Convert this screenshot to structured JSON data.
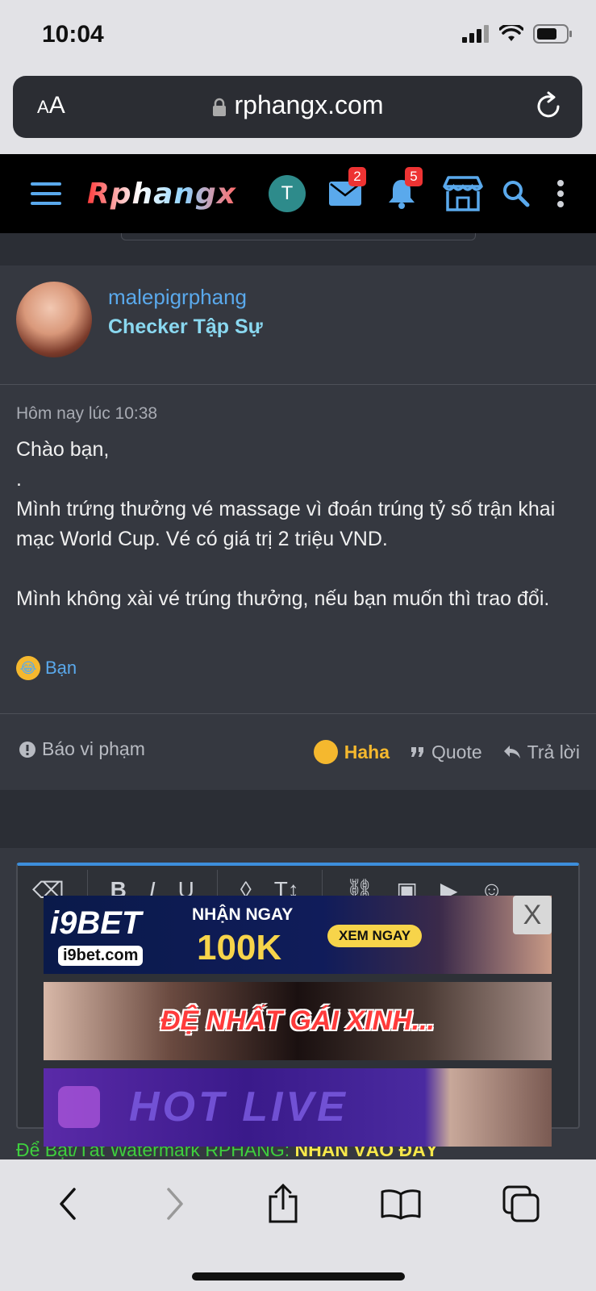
{
  "status_bar": {
    "time": "10:04"
  },
  "browser": {
    "text_size_label": "AA",
    "url": "rphangx.com"
  },
  "header": {
    "logo": "Rphangx",
    "user_initial": "T",
    "messages_count": "2",
    "alerts_count": "5"
  },
  "post": {
    "username": "malepigrphang",
    "user_title": "Checker Tập Sự",
    "timestamp": "Hôm nay lúc 10:38",
    "body": [
      "Chào bạn,",
      ".",
      "Mình trứng thưởng vé massage vì đoán trúng tỷ số trận khai mạc World Cup. Vé có giá trị 2 triệu VND.",
      "",
      "Mình không xài vé trúng thưởng, nếu bạn muốn thì trao đổi."
    ],
    "reaction_user": "Bạn",
    "report_label": "Báo vi phạm",
    "haha_label": "Haha",
    "quote_label": "Quote",
    "reply_label": "Trả lời"
  },
  "editor": {
    "toolbar": [
      "eraser",
      "bold",
      "italic",
      "underline",
      "color",
      "text-size",
      "link",
      "image",
      "media",
      "emoji"
    ]
  },
  "ads": {
    "ad1": {
      "brand": "i9BET",
      "site": "i9bet.com",
      "headline": "NHẬN NGAY",
      "amount": "100K",
      "cta": "XEM NGAY",
      "close": "X"
    },
    "ad2": {
      "text": "ĐỆ NHẤT GÁI XINH..."
    },
    "ad3": {
      "text": "HOT LIVE"
    }
  },
  "watermark": {
    "prefix": "Để Bật/Tắt Watermark RPHANG: ",
    "cta": "NHẤN VÀO ĐÂY"
  }
}
